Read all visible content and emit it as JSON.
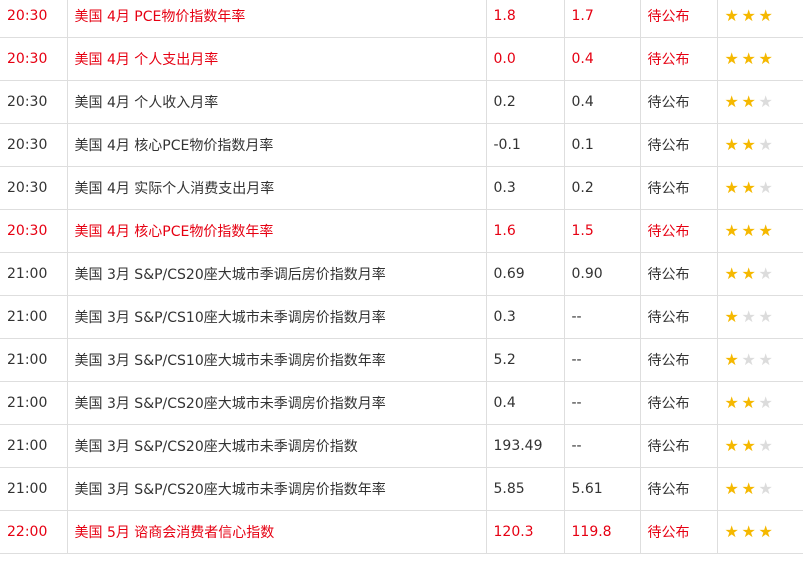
{
  "colors": {
    "highlight": "#e60012",
    "star_on": "#f5b800",
    "star_off": "#dcdcdc"
  },
  "rows": [
    {
      "time": "20:30",
      "event": "美国 4月 PCE物价指数年率",
      "actual": "1.8",
      "previous": "1.7",
      "status": "待公布",
      "stars": 3,
      "highlight": true
    },
    {
      "time": "20:30",
      "event": "美国 4月 个人支出月率",
      "actual": "0.0",
      "previous": "0.4",
      "status": "待公布",
      "stars": 3,
      "highlight": true
    },
    {
      "time": "20:30",
      "event": "美国 4月 个人收入月率",
      "actual": "0.2",
      "previous": "0.4",
      "status": "待公布",
      "stars": 2,
      "highlight": false
    },
    {
      "time": "20:30",
      "event": "美国 4月 核心PCE物价指数月率",
      "actual": "-0.1",
      "previous": "0.1",
      "status": "待公布",
      "stars": 2,
      "highlight": false
    },
    {
      "time": "20:30",
      "event": "美国 4月 实际个人消费支出月率",
      "actual": "0.3",
      "previous": "0.2",
      "status": "待公布",
      "stars": 2,
      "highlight": false
    },
    {
      "time": "20:30",
      "event": "美国 4月 核心PCE物价指数年率",
      "actual": "1.6",
      "previous": "1.5",
      "status": "待公布",
      "stars": 3,
      "highlight": true
    },
    {
      "time": "21:00",
      "event": "美国 3月 S&P/CS20座大城市季调后房价指数月率",
      "actual": "0.69",
      "previous": "0.90",
      "status": "待公布",
      "stars": 2,
      "highlight": false
    },
    {
      "time": "21:00",
      "event": "美国 3月 S&P/CS10座大城市未季调房价指数月率",
      "actual": "0.3",
      "previous": "--",
      "status": "待公布",
      "stars": 1,
      "highlight": false
    },
    {
      "time": "21:00",
      "event": "美国 3月 S&P/CS10座大城市未季调房价指数年率",
      "actual": "5.2",
      "previous": "--",
      "status": "待公布",
      "stars": 1,
      "highlight": false
    },
    {
      "time": "21:00",
      "event": "美国 3月 S&P/CS20座大城市未季调房价指数月率",
      "actual": "0.4",
      "previous": "--",
      "status": "待公布",
      "stars": 2,
      "highlight": false
    },
    {
      "time": "21:00",
      "event": "美国 3月 S&P/CS20座大城市未季调房价指数",
      "actual": "193.49",
      "previous": "--",
      "status": "待公布",
      "stars": 2,
      "highlight": false
    },
    {
      "time": "21:00",
      "event": "美国 3月 S&P/CS20座大城市未季调房价指数年率",
      "actual": "5.85",
      "previous": "5.61",
      "status": "待公布",
      "stars": 2,
      "highlight": false
    },
    {
      "time": "22:00",
      "event": "美国 5月 谘商会消费者信心指数",
      "actual": "120.3",
      "previous": "119.8",
      "status": "待公布",
      "stars": 3,
      "highlight": true
    }
  ]
}
